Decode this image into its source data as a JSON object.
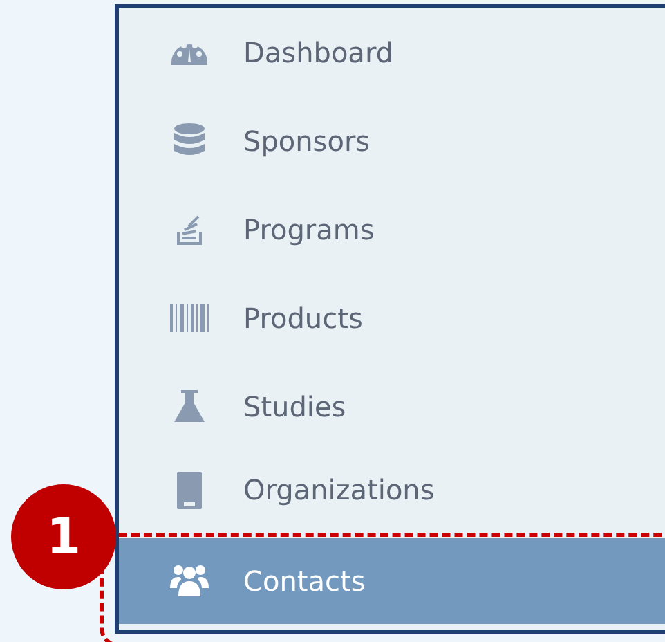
{
  "sidebar": {
    "items": [
      {
        "label": "Dashboard",
        "selected": false
      },
      {
        "label": "Sponsors",
        "selected": false
      },
      {
        "label": "Programs",
        "selected": false
      },
      {
        "label": "Products",
        "selected": false
      },
      {
        "label": "Studies",
        "selected": false
      },
      {
        "label": "Organizations",
        "selected": false
      },
      {
        "label": "Contacts",
        "selected": true
      }
    ]
  },
  "callout": {
    "number": "1"
  }
}
